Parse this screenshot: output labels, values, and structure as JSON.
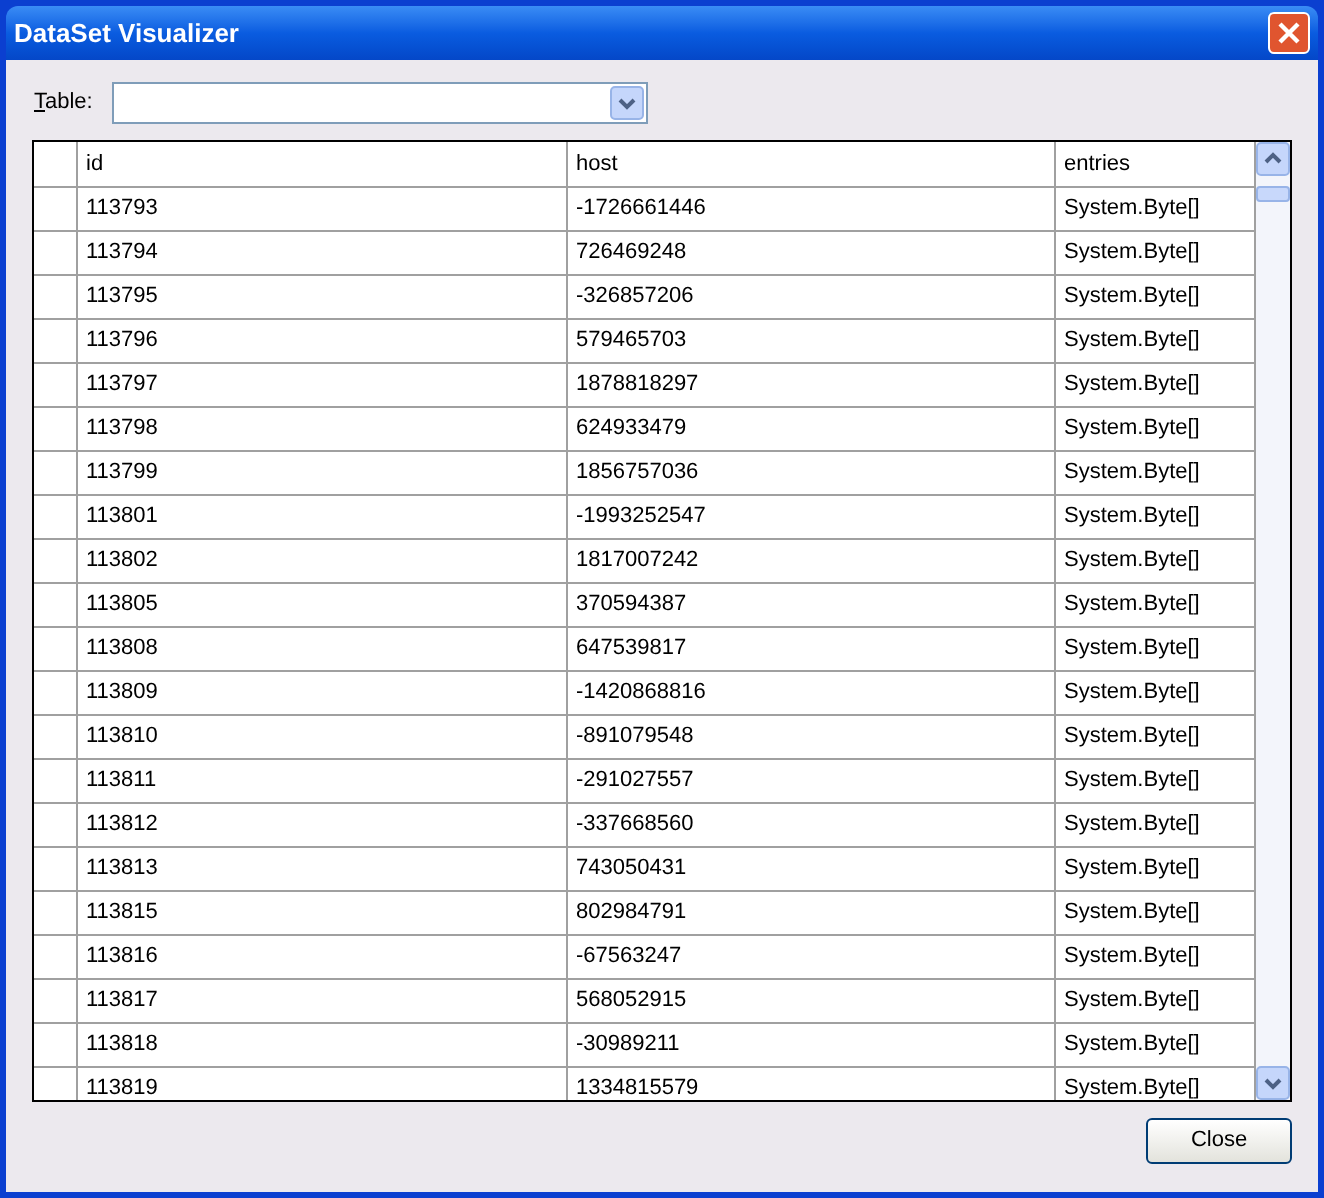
{
  "window": {
    "title": "DataSet Visualizer"
  },
  "table_picker": {
    "label": "Table:"
  },
  "table": {
    "columns": [
      "id",
      "host",
      "entries"
    ],
    "rows": [
      [
        "113793",
        "-1726661446",
        "System.Byte[]"
      ],
      [
        "113794",
        "726469248",
        "System.Byte[]"
      ],
      [
        "113795",
        "-326857206",
        "System.Byte[]"
      ],
      [
        "113796",
        "579465703",
        "System.Byte[]"
      ],
      [
        "113797",
        "1878818297",
        "System.Byte[]"
      ],
      [
        "113798",
        "624933479",
        "System.Byte[]"
      ],
      [
        "113799",
        "1856757036",
        "System.Byte[]"
      ],
      [
        "113801",
        "-1993252547",
        "System.Byte[]"
      ],
      [
        "113802",
        "1817007242",
        "System.Byte[]"
      ],
      [
        "113805",
        "370594387",
        "System.Byte[]"
      ],
      [
        "113808",
        "647539817",
        "System.Byte[]"
      ],
      [
        "113809",
        "-1420868816",
        "System.Byte[]"
      ],
      [
        "113810",
        "-891079548",
        "System.Byte[]"
      ],
      [
        "113811",
        "-291027557",
        "System.Byte[]"
      ],
      [
        "113812",
        "-337668560",
        "System.Byte[]"
      ],
      [
        "113813",
        "743050431",
        "System.Byte[]"
      ],
      [
        "113815",
        "802984791",
        "System.Byte[]"
      ],
      [
        "113816",
        "-67563247",
        "System.Byte[]"
      ],
      [
        "113817",
        "568052915",
        "System.Byte[]"
      ],
      [
        "113818",
        "-30989211",
        "System.Byte[]"
      ],
      [
        "113819",
        "1334815579",
        "System.Byte[]"
      ]
    ]
  },
  "buttons": [
    "Close"
  ]
}
